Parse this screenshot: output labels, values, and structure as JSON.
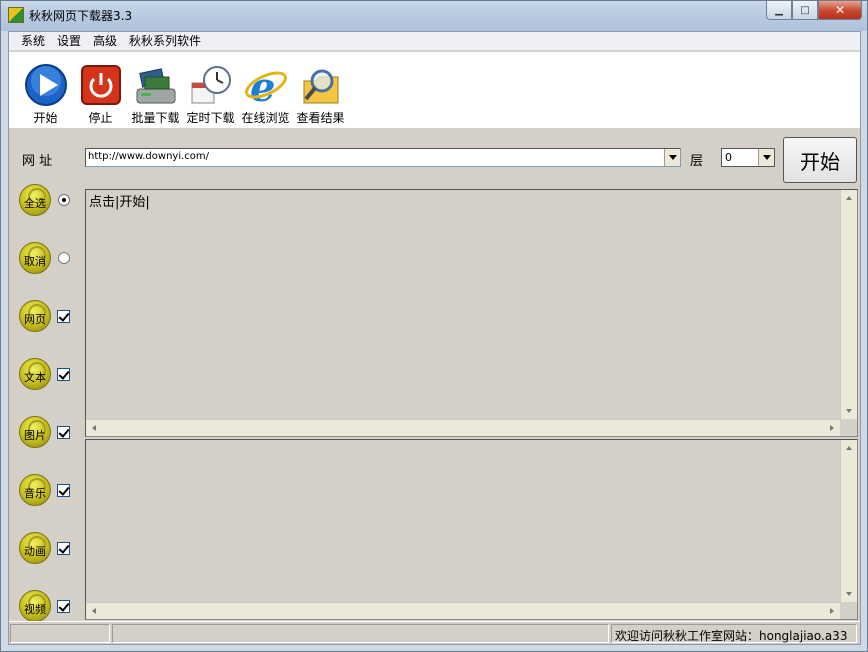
{
  "window": {
    "title": "秋秋网页下载器3.3"
  },
  "menu": [
    "系统",
    "设置",
    "高级",
    "秋秋系列软件"
  ],
  "toolbar": [
    {
      "label": "开始",
      "icon": "play-icon"
    },
    {
      "label": "停止",
      "icon": "power-icon"
    },
    {
      "label": "批量下载",
      "icon": "books-drive-icon"
    },
    {
      "label": "定时下载",
      "icon": "clock-calendar-icon"
    },
    {
      "label": "在线浏览",
      "icon": "ie-browser-icon"
    },
    {
      "label": "查看结果",
      "icon": "folder-magnifier-icon"
    }
  ],
  "url": {
    "label": "网 址",
    "value": "http://www.downyi.com/"
  },
  "layer": {
    "label": "层",
    "value": "0"
  },
  "start_button": "开始",
  "filters": [
    {
      "label": "全选",
      "control": "radio",
      "checked": true
    },
    {
      "label": "取消",
      "control": "radio",
      "checked": false
    },
    {
      "label": "网页",
      "control": "checkbox",
      "checked": true
    },
    {
      "label": "文本",
      "control": "checkbox",
      "checked": true
    },
    {
      "label": "图片",
      "control": "checkbox",
      "checked": true
    },
    {
      "label": "音乐",
      "control": "checkbox",
      "checked": true
    },
    {
      "label": "动画",
      "control": "checkbox",
      "checked": true
    },
    {
      "label": "视频",
      "control": "checkbox",
      "checked": true
    }
  ],
  "log": {
    "text": "点击|开始|"
  },
  "status": {
    "right_text": "欢迎访问秋秋工作室网站：honglajiao.a33"
  }
}
